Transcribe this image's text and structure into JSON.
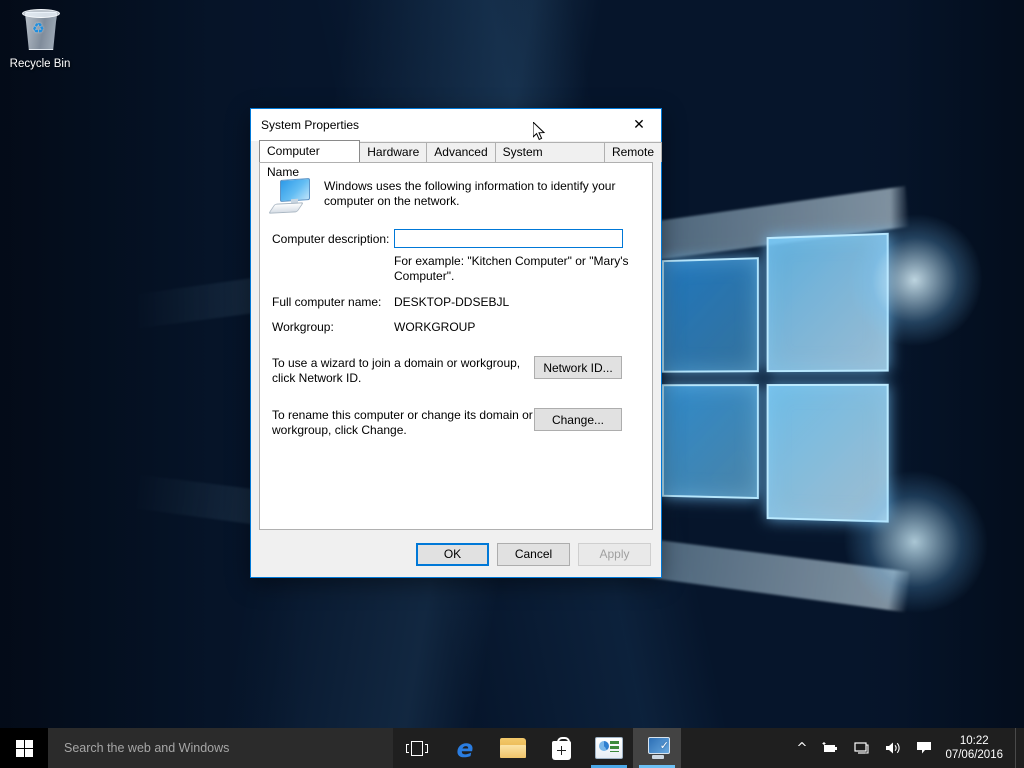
{
  "desktop": {
    "recycle_bin": {
      "label": "Recycle Bin",
      "icon": "recycle-bin-icon"
    },
    "wallpaper": "windows-10-hero-blue"
  },
  "dialog": {
    "title": "System Properties",
    "close_icon": "close-icon",
    "tabs": [
      {
        "label": "Computer Name",
        "active": true
      },
      {
        "label": "Hardware",
        "active": false
      },
      {
        "label": "Advanced",
        "active": false
      },
      {
        "label": "System Protection",
        "active": false
      },
      {
        "label": "Remote",
        "active": false
      }
    ],
    "panel": {
      "icon": "computer-monitor-icon",
      "intro_text": "Windows uses the following information to identify your computer on the network.",
      "description_label": "Computer description:",
      "description_value": "",
      "description_placeholder": "",
      "description_hint": "For example: \"Kitchen Computer\" or \"Mary's Computer\".",
      "full_name_label": "Full computer name:",
      "full_name_value": "DESKTOP-DDSEBJL",
      "workgroup_label": "Workgroup:",
      "workgroup_value": "WORKGROUP",
      "network_id_text": "To use a wizard to join a domain or workgroup, click Network ID.",
      "network_id_button": "Network ID...",
      "change_text": "To rename this computer or change its domain or workgroup, click Change.",
      "change_button": "Change..."
    },
    "footer": {
      "ok": "OK",
      "cancel": "Cancel",
      "apply": "Apply",
      "apply_enabled": false
    },
    "accent_color": "#0078d7"
  },
  "taskbar": {
    "start_icon": "windows-start-icon",
    "search_placeholder": "Search the web and Windows",
    "search_value": "",
    "items": [
      {
        "name": "task-view-icon",
        "running": false,
        "active": false
      },
      {
        "name": "microsoft-edge-icon",
        "running": false,
        "active": false
      },
      {
        "name": "file-explorer-icon",
        "running": false,
        "active": false
      },
      {
        "name": "microsoft-store-icon",
        "running": false,
        "active": false
      },
      {
        "name": "control-panel-icon",
        "running": true,
        "active": false
      },
      {
        "name": "system-properties-icon",
        "running": true,
        "active": true
      }
    ],
    "tray": [
      {
        "name": "show-hidden-icons-chevron",
        "glyph": "⌃"
      },
      {
        "name": "power-battery-icon",
        "glyph": ""
      },
      {
        "name": "network-icon",
        "glyph": ""
      },
      {
        "name": "volume-icon",
        "glyph": ""
      },
      {
        "name": "action-center-icon",
        "glyph": ""
      }
    ],
    "clock": {
      "time": "10:22",
      "date": "07/06/2016"
    }
  }
}
